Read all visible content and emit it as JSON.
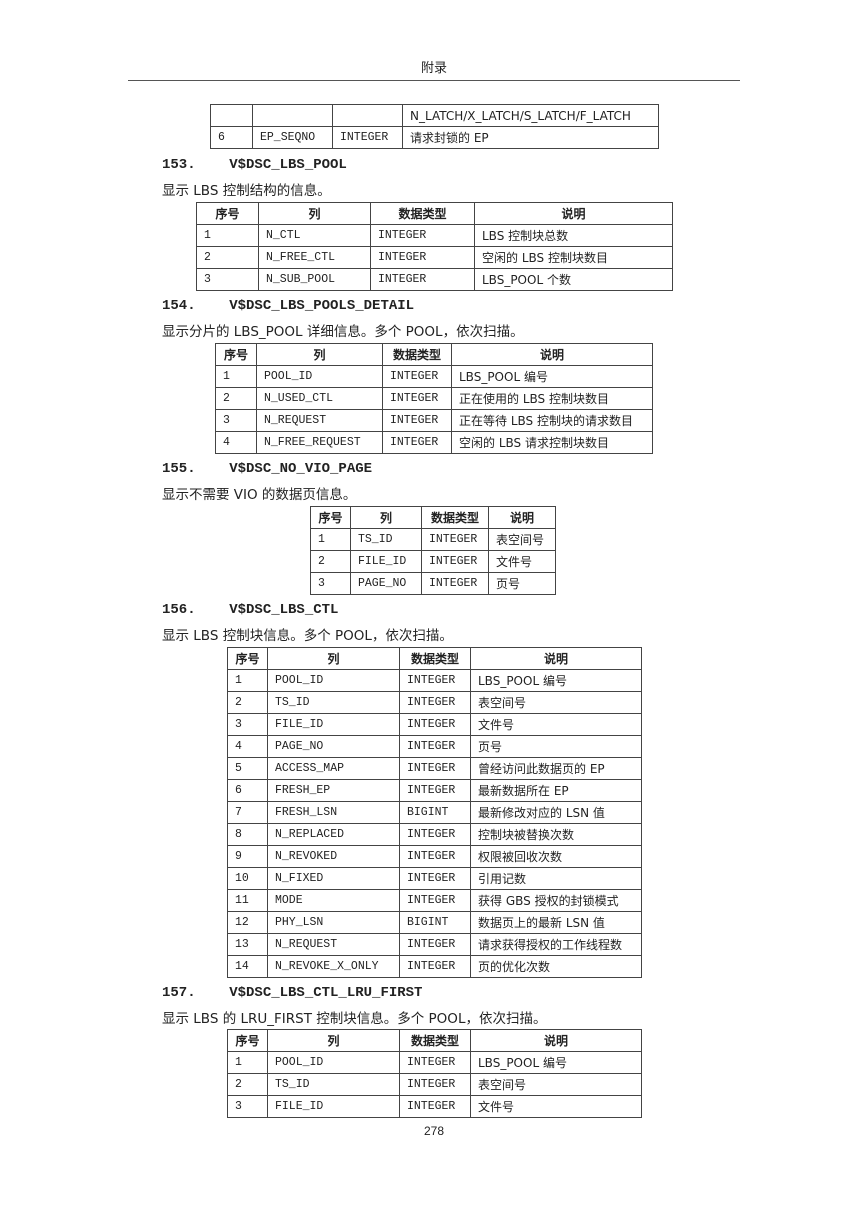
{
  "header": "附录",
  "page_number": "278",
  "carry_table": {
    "rows": [
      [
        "",
        "",
        "",
        "N_LATCH/X_LATCH/S_LATCH/F_LATCH"
      ],
      [
        "6",
        "EP_SEQNO",
        "INTEGER",
        "请求封锁的 EP"
      ]
    ]
  },
  "sections": [
    {
      "number": "153.",
      "title": "V$DSC_LBS_POOL",
      "description": "显示 LBS 控制结构的信息。",
      "headers": [
        "序号",
        "列",
        "数据类型",
        "说明"
      ],
      "rows": [
        [
          "1",
          "N_CTL",
          "INTEGER",
          "LBS 控制块总数"
        ],
        [
          "2",
          "N_FREE_CTL",
          "INTEGER",
          "空闲的 LBS 控制块数目"
        ],
        [
          "3",
          "N_SUB_POOL",
          "INTEGER",
          "LBS_POOL 个数"
        ]
      ]
    },
    {
      "number": "154.",
      "title": "V$DSC_LBS_POOLS_DETAIL",
      "description": "显示分片的 LBS_POOL 详细信息。多个 POOL，依次扫描。",
      "headers": [
        "序号",
        "列",
        "数据类型",
        "说明"
      ],
      "rows": [
        [
          "1",
          "POOL_ID",
          "INTEGER",
          "LBS_POOL 编号"
        ],
        [
          "2",
          "N_USED_CTL",
          "INTEGER",
          "正在使用的 LBS 控制块数目"
        ],
        [
          "3",
          "N_REQUEST",
          "INTEGER",
          "正在等待 LBS 控制块的请求数目"
        ],
        [
          "4",
          "N_FREE_REQUEST",
          "INTEGER",
          "空闲的 LBS 请求控制块数目"
        ]
      ]
    },
    {
      "number": "155.",
      "title": "V$DSC_NO_VIO_PAGE",
      "description": "显示不需要 VIO 的数据页信息。",
      "headers": [
        "序号",
        "列",
        "数据类型",
        "说明"
      ],
      "rows": [
        [
          "1",
          "TS_ID",
          "INTEGER",
          "表空间号"
        ],
        [
          "2",
          "FILE_ID",
          "INTEGER",
          "文件号"
        ],
        [
          "3",
          "PAGE_NO",
          "INTEGER",
          "页号"
        ]
      ]
    },
    {
      "number": "156.",
      "title": "V$DSC_LBS_CTL",
      "description": "显示 LBS 控制块信息。多个 POOL，依次扫描。",
      "headers": [
        "序号",
        "列",
        "数据类型",
        "说明"
      ],
      "rows": [
        [
          "1",
          "POOL_ID",
          "INTEGER",
          "LBS_POOL 编号"
        ],
        [
          "2",
          "TS_ID",
          "INTEGER",
          "表空间号"
        ],
        [
          "3",
          "FILE_ID",
          "INTEGER",
          "文件号"
        ],
        [
          "4",
          "PAGE_NO",
          "INTEGER",
          "页号"
        ],
        [
          "5",
          "ACCESS_MAP",
          "INTEGER",
          "曾经访问此数据页的 EP"
        ],
        [
          "6",
          "FRESH_EP",
          "INTEGER",
          "最新数据所在 EP"
        ],
        [
          "7",
          "FRESH_LSN",
          "BIGINT",
          "最新修改对应的 LSN 值"
        ],
        [
          "8",
          "N_REPLACED",
          "INTEGER",
          "控制块被替换次数"
        ],
        [
          "9",
          "N_REVOKED",
          "INTEGER",
          "权限被回收次数"
        ],
        [
          "10",
          "N_FIXED",
          "INTEGER",
          "引用记数"
        ],
        [
          "11",
          "MODE",
          "INTEGER",
          "获得 GBS 授权的封锁模式"
        ],
        [
          "12",
          "PHY_LSN",
          "BIGINT",
          "数据页上的最新 LSN 值"
        ],
        [
          "13",
          "N_REQUEST",
          "INTEGER",
          "请求获得授权的工作线程数"
        ],
        [
          "14",
          "N_REVOKE_X_ONLY",
          "INTEGER",
          "页的优化次数"
        ]
      ]
    },
    {
      "number": "157.",
      "title": "V$DSC_LBS_CTL_LRU_FIRST",
      "description": "显示 LBS 的 LRU_FIRST 控制块信息。多个 POOL，依次扫描。",
      "headers": [
        "序号",
        "列",
        "数据类型",
        "说明"
      ],
      "rows": [
        [
          "1",
          "POOL_ID",
          "INTEGER",
          "LBS_POOL 编号"
        ],
        [
          "2",
          "TS_ID",
          "INTEGER",
          "表空间号"
        ],
        [
          "3",
          "FILE_ID",
          "INTEGER",
          "文件号"
        ]
      ]
    }
  ]
}
